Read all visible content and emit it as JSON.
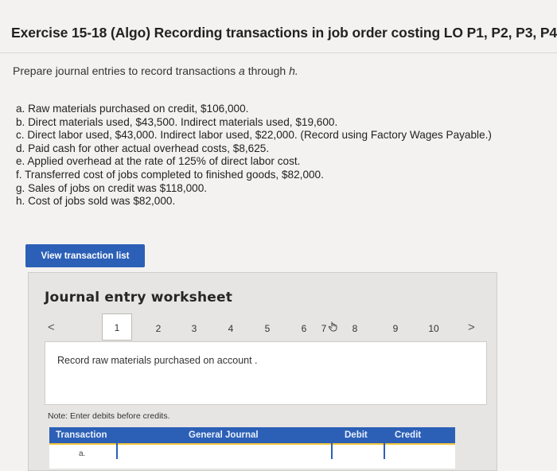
{
  "page": {
    "title": "Exercise 15-18 (Algo) Recording transactions in job order costing LO P1, P2, P3, P4",
    "prompt_text": "Prepare journal entries to record transactions ",
    "prompt_a": "a",
    "prompt_through": " through ",
    "prompt_h": "h."
  },
  "transactions": [
    "a. Raw materials purchased on credit, $106,000.",
    "b. Direct materials used, $43,500. Indirect materials used, $19,600.",
    "c. Direct labor used, $43,000. Indirect labor used, $22,000. (Record using Factory Wages Payable.)",
    "d. Paid cash for other actual overhead costs, $8,625.",
    "e. Applied overhead at the rate of 125% of direct labor cost.",
    "f. Transferred cost of jobs completed to finished goods, $82,000.",
    "g. Sales of jobs on credit was $118,000.",
    "h. Cost of jobs sold was $82,000."
  ],
  "view_button_label": "View transaction list",
  "worksheet": {
    "title": "Journal entry worksheet",
    "pages": [
      "1",
      "2",
      "3",
      "4",
      "5",
      "6",
      "7",
      "8",
      "9",
      "10"
    ],
    "active_page": "1",
    "prev": "<",
    "next": ">",
    "description": "Record raw materials purchased on account .",
    "note": "Note: Enter debits before credits.",
    "table": {
      "headers": [
        "Transaction",
        "General Journal",
        "Debit",
        "Credit"
      ],
      "rows": [
        [
          "a.",
          "",
          "",
          ""
        ]
      ]
    }
  },
  "colors": {
    "accent": "#2c60b7",
    "header_underline": "#f0c33c",
    "background": "#f3f2f0"
  }
}
